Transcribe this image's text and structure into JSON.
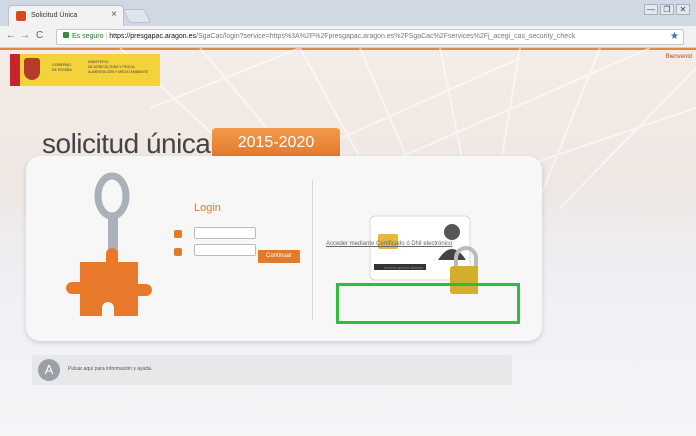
{
  "browser": {
    "tab_title": "Solicitud Única",
    "tab_close": "×",
    "controls": [
      "—",
      "❐",
      "✕"
    ],
    "nav": {
      "back": "←",
      "forward": "→",
      "reload": "C"
    },
    "url": {
      "secure_label": "Es seguro",
      "host": "https://presgapac.aragon.es",
      "path": "/SgaCac/login?service=https%3A%2F%2Fpresgapac.aragon.es%2FSgaCac%2Fservices%2Fj_acegi_cas_security_check"
    },
    "bookmark_icon": "star-icon"
  },
  "header": {
    "logo_lines": [
      "GOBIERNO",
      "DE ESPAÑA"
    ],
    "ministry_lines": [
      "MINISTERIO",
      "DE AGRICULTURA Y PESCA,",
      "ALIMENTACIÓN Y MEDIO AMBIENTE"
    ],
    "welcome": "Bienvenid"
  },
  "page": {
    "title": "solicitud única",
    "years": "2015-2020"
  },
  "login": {
    "title": "Login",
    "user_icon": "user-icon",
    "password_icon": "padlock-icon",
    "continue_label": "Continuar"
  },
  "certificate": {
    "card_name": "Nombre Apellido Nombre",
    "link": "Acceder mediante Certificado ó DNI electrónico"
  },
  "help": {
    "badge": "A",
    "text": "Pulsar aquí para información y ayuda."
  },
  "colors": {
    "accent": "#e27a2a",
    "highlight": "#2ebd3c"
  }
}
